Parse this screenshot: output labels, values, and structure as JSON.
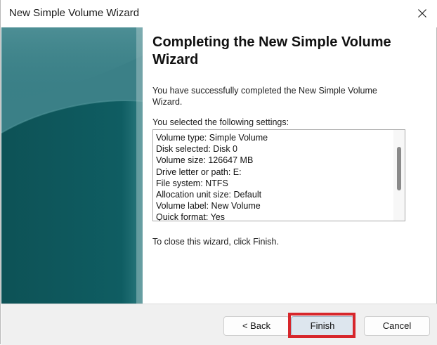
{
  "window": {
    "title": "New Simple Volume Wizard"
  },
  "icons": {
    "close": "close-icon"
  },
  "main": {
    "heading": "Completing the New Simple Volume Wizard",
    "intro": "You have successfully completed the New Simple Volume Wizard.",
    "settings_label": "You selected the following settings:",
    "settings": [
      "Volume type: Simple Volume",
      "Disk selected: Disk 0",
      "Volume size: 126647 MB",
      "Drive letter or path: E:",
      "File system: NTFS",
      "Allocation unit size: Default",
      "Volume label: New Volume",
      "Quick format: Yes"
    ],
    "close_hint": "To close this wizard, click Finish."
  },
  "buttons": {
    "back": "< Back",
    "finish": "Finish",
    "cancel": "Cancel"
  },
  "colors": {
    "highlight": "#d7262b",
    "panel_teal": "#236a70"
  }
}
